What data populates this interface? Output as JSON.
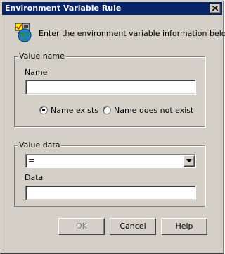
{
  "window": {
    "title": "Environment Variable Rule"
  },
  "intro": {
    "text": "Enter the environment variable information below.",
    "icon": "environment-globe-icon"
  },
  "value_name_group": {
    "legend": "Value name",
    "name_label": "Name",
    "name_value": "",
    "radios": [
      {
        "label": "Name exists",
        "checked": true
      },
      {
        "label": "Name does not exist",
        "checked": false
      }
    ]
  },
  "value_data_group": {
    "legend": "Value data",
    "operator_selected": "=",
    "data_label": "Data",
    "data_value": ""
  },
  "buttons": {
    "ok": "OK",
    "ok_disabled": true,
    "cancel": "Cancel",
    "help": "Help"
  },
  "colors": {
    "titlebar": "#0a246a",
    "face": "#d4d0c8"
  }
}
